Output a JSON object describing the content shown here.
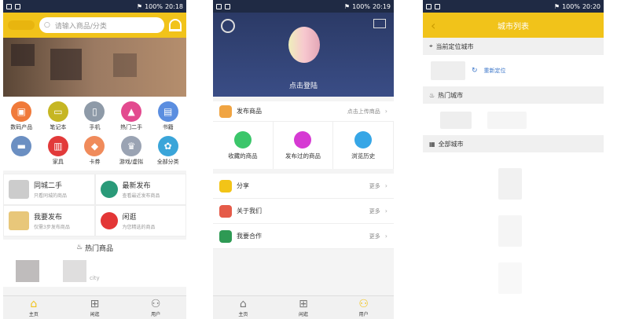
{
  "statusbars": [
    {
      "time": "20:18",
      "battery": "100%"
    },
    {
      "time": "20:19",
      "battery": "100%"
    },
    {
      "time": "20:20",
      "battery": "100%"
    }
  ],
  "home": {
    "search_placeholder": "请输入商品/分类",
    "categories": [
      {
        "label": "数码产品",
        "color": "#f07a3a",
        "icon": "phone-icon"
      },
      {
        "label": "笔记本",
        "color": "#c6b623",
        "icon": "laptop-icon"
      },
      {
        "label": "手机",
        "color": "#8e9aa8",
        "icon": "mobile-icon"
      },
      {
        "label": "热门二手",
        "color": "#e34a8f",
        "icon": "fire-icon"
      },
      {
        "label": "书籍",
        "color": "#5b8ee0",
        "icon": "book-icon"
      },
      {
        "label": "",
        "color": "#6b8fc2",
        "icon": "car-icon"
      },
      {
        "label": "家具",
        "color": "#e23a3a",
        "icon": "furniture-icon"
      },
      {
        "label": "卡券",
        "color": "#f08b5b",
        "icon": "coupon-icon"
      },
      {
        "label": "游戏/虚拟",
        "color": "#9aa3b3",
        "icon": "game-icon"
      },
      {
        "label": "全部分类",
        "color": "#3aa5d9",
        "icon": "all-icon"
      }
    ],
    "promos": [
      {
        "title": "同城二手",
        "subtitle": "只看同城的商品"
      },
      {
        "title": "最新发布",
        "subtitle": "查看最近发布商品"
      },
      {
        "title": "我要发布",
        "subtitle": "仅需3步发布商品"
      },
      {
        "title": "闲逛",
        "subtitle": "为您精选的商品"
      }
    ],
    "hot_title": "热门商品",
    "hot_text": "city"
  },
  "tabs": [
    "主页",
    "闲逛",
    "用户"
  ],
  "profile": {
    "login_text": "点击登陆",
    "publish": {
      "label": "发布商品",
      "right": "点击上传商品"
    },
    "grid": [
      "收藏的商品",
      "发布过的商品",
      "浏览历史"
    ],
    "list": [
      {
        "label": "分享",
        "right": "更多"
      },
      {
        "label": "关于我们",
        "right": "更多"
      },
      {
        "label": "我要合作",
        "right": "更多"
      }
    ]
  },
  "city": {
    "title": "城市列表",
    "current_label": "当前定位城市",
    "relocate": "重新定位",
    "hot_label": "热门城市",
    "all_label": "全部城市"
  }
}
